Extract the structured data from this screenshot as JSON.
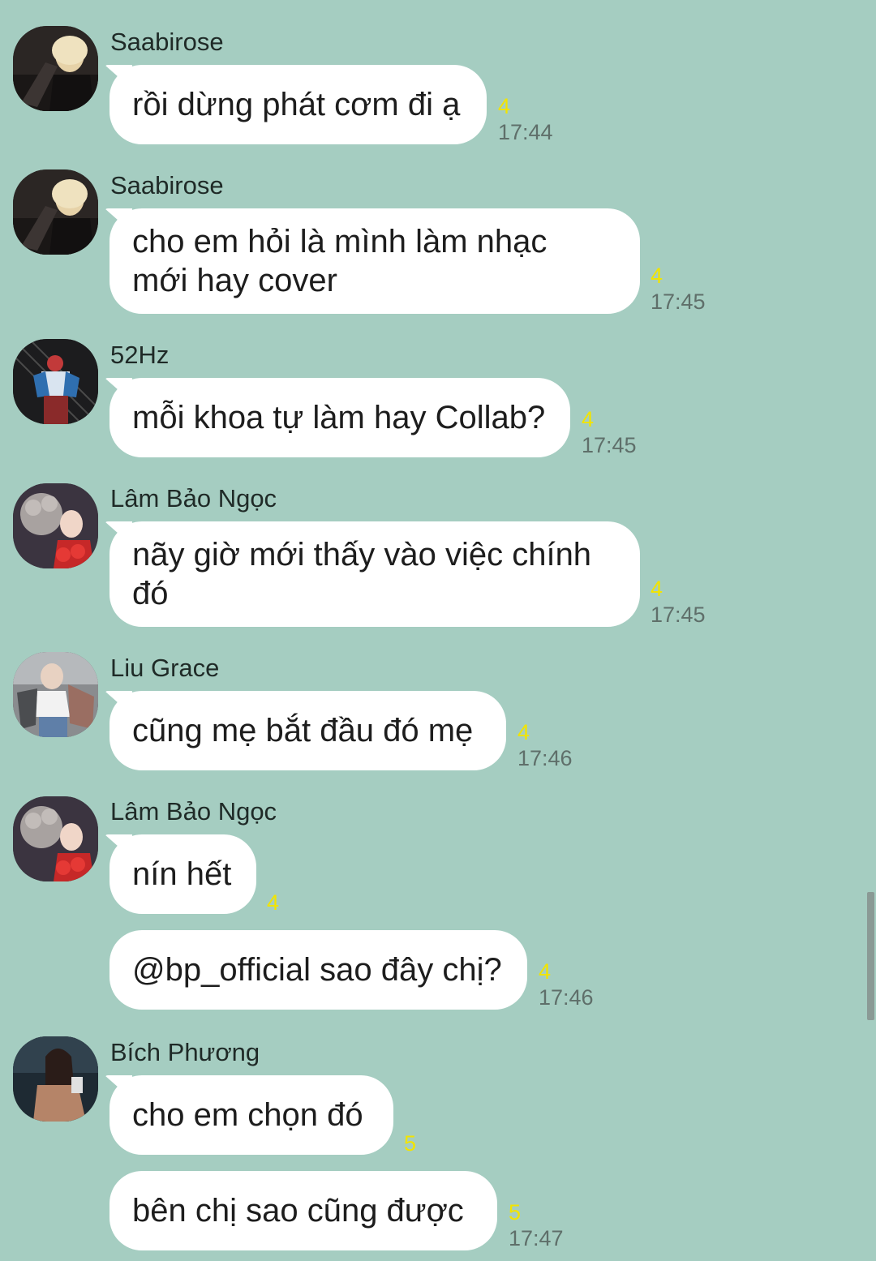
{
  "colors": {
    "background": "#a5cdc1",
    "bubble": "#ffffff",
    "seen_count": "#f2e400",
    "timestamp": "#5f6f6a"
  },
  "messages": [
    {
      "sender": "Saabirose",
      "avatar": "avatar-saabirose",
      "text": "rồi dừng phát cơm đi ạ",
      "seen": "4",
      "time": "17:44"
    },
    {
      "sender": "Saabirose",
      "avatar": "avatar-saabirose",
      "text": "cho em hỏi là mình làm nhạc\nmới hay cover",
      "seen": "4",
      "time": "17:45"
    },
    {
      "sender": "52Hz",
      "avatar": "avatar-52hz",
      "text": "mỗi khoa tự làm hay Collab?",
      "seen": "4",
      "time": "17:45"
    },
    {
      "sender": "Lâm Bảo Ngọc",
      "avatar": "avatar-lam-bao-ngoc",
      "text": "nãy giờ mới thấy vào việc chính\nđó",
      "seen": "4",
      "time": "17:45"
    },
    {
      "sender": "Liu Grace",
      "avatar": "avatar-liu-grace",
      "text": "cũng mẹ bắt đầu đó mẹ",
      "seen": "4",
      "time": "17:46"
    },
    {
      "sender": "Lâm Bảo Ngọc",
      "avatar": "avatar-lam-bao-ngoc",
      "text": "nín hết",
      "seen": "4",
      "time": ""
    },
    {
      "sender": "",
      "avatar": "",
      "text": "@bp_official sao đây chị?",
      "seen": "4",
      "time": "17:46"
    },
    {
      "sender": "Bích Phương",
      "avatar": "avatar-bich-phuong",
      "text": "cho em chọn đó",
      "seen": "5",
      "time": ""
    },
    {
      "sender": "",
      "avatar": "",
      "text": "bên chị sao cũng được",
      "seen": "5",
      "time": "17:47"
    }
  ]
}
